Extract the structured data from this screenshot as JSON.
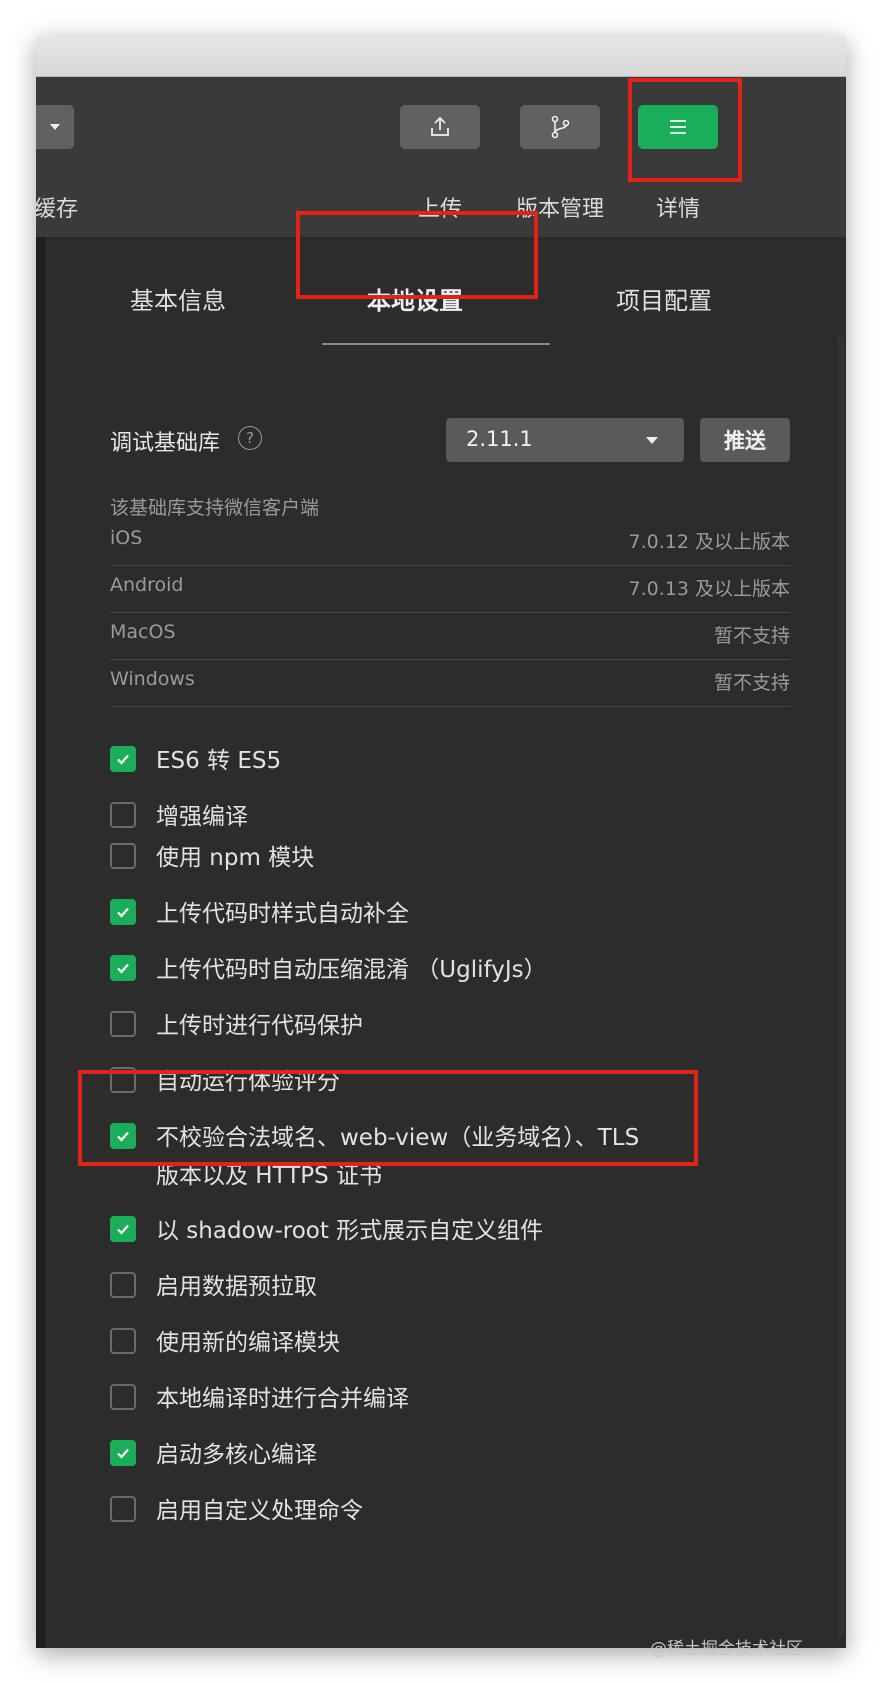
{
  "toolbar": {
    "left_partial_label": "缓存",
    "buttons": [
      {
        "label": "上传",
        "icon": "upload-icon"
      },
      {
        "label": "版本管理",
        "icon": "branch-icon"
      },
      {
        "label": "详情",
        "icon": "menu-icon"
      }
    ]
  },
  "tabs": [
    "基本信息",
    "本地设置",
    "项目配置"
  ],
  "active_tab": "本地设置",
  "debug_lib": {
    "label": "调试基础库",
    "help_icon": "question-icon",
    "version": "2.11.1",
    "push_label": "推送"
  },
  "support": {
    "heading": "该基础库支持微信客户端",
    "rows": [
      {
        "platform": "iOS",
        "status": "7.0.12 及以上版本"
      },
      {
        "platform": "Android",
        "status": "7.0.13 及以上版本"
      },
      {
        "platform": "MacOS",
        "status": "暂不支持"
      },
      {
        "platform": "Windows",
        "status": "暂不支持"
      }
    ]
  },
  "options": [
    {
      "label": "ES6 转 ES5",
      "checked": true
    },
    {
      "label": "增强编译",
      "checked": false
    },
    {
      "label": "使用 npm 模块",
      "checked": false
    },
    {
      "label": "上传代码时样式自动补全",
      "checked": true
    },
    {
      "label": "上传代码时自动压缩混淆 （UglifyJs）",
      "checked": true
    },
    {
      "label": "上传时进行代码保护",
      "checked": false
    },
    {
      "label": "自动运行体验评分",
      "checked": false
    },
    {
      "label_line1": "不校验合法域名、web-view（业务域名）、TLS",
      "label_line2": "版本以及 HTTPS 证书",
      "checked": true
    },
    {
      "label": "以 shadow-root 形式展示自定义组件",
      "checked": true
    },
    {
      "label": "启用数据预拉取",
      "checked": false
    },
    {
      "label": "使用新的编译模块",
      "checked": false
    },
    {
      "label": "本地编译时进行合并编译",
      "checked": false
    },
    {
      "label": "启动多核心编译",
      "checked": true
    },
    {
      "label": "启用自定义处理命令",
      "checked": false
    }
  ],
  "colors": {
    "accent_green": "#1aad5a",
    "highlight_red": "#e0241a",
    "panel_bg": "#2c2c2c"
  },
  "watermark": "@稀土掘金技术社区"
}
